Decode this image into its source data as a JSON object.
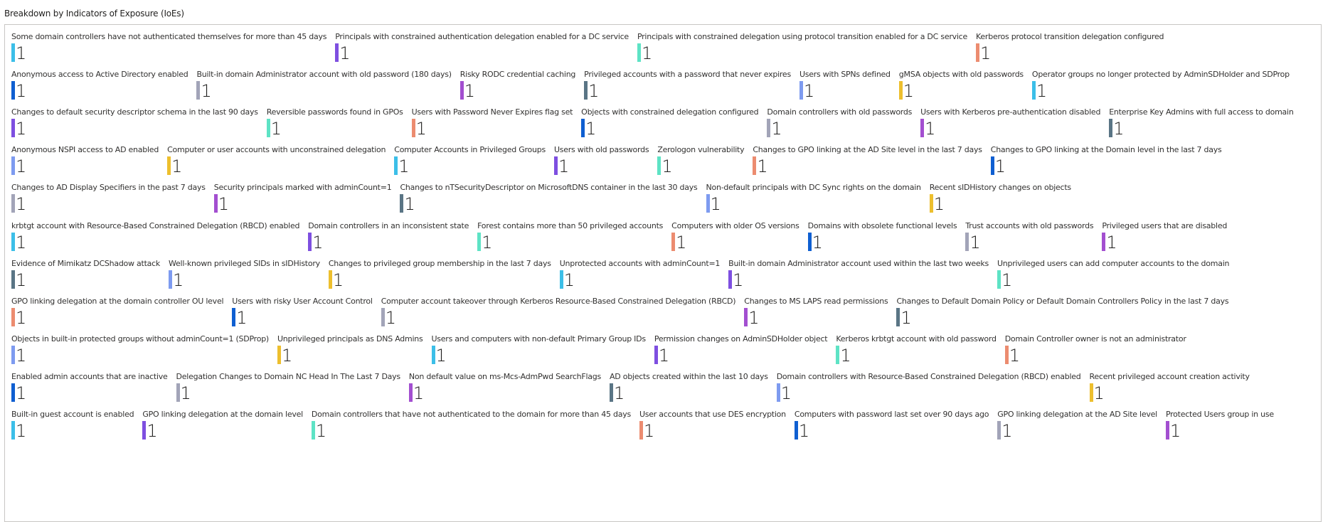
{
  "panel_title": "Breakdown by Indicators of Exposure (IoEs)",
  "colors": {
    "cyan": "#3cbfe8",
    "purple": "#7e4fe0",
    "mint": "#5ee3c5",
    "salmon": "#ec8c70",
    "blue": "#0f5fd1",
    "gray": "#a2a4b8",
    "magenta": "#a34fd0",
    "slate": "#5a7585",
    "periwinkle": "#7e9bf0",
    "gold": "#edbf2e"
  },
  "rows": [
    [
      {
        "label": "Some domain controllers have not authenticated themselves for more than 45 days",
        "value": "1",
        "color": "cyan"
      },
      {
        "label": "Principals with constrained authentication delegation enabled for a DC service",
        "value": "1",
        "color": "purple"
      },
      {
        "label": "Principals with constrained delegation using protocol transition enabled for a DC service",
        "value": "1",
        "color": "mint"
      },
      {
        "label": "Kerberos protocol transition delegation configured",
        "value": "1",
        "color": "salmon"
      }
    ],
    [
      {
        "label": "Anonymous access to Active Directory enabled",
        "value": "1",
        "color": "blue"
      },
      {
        "label": "Built-in domain Administrator account with old password (180 days)",
        "value": "1",
        "color": "gray"
      },
      {
        "label": "Risky RODC credential caching",
        "value": "1",
        "color": "magenta"
      },
      {
        "label": "Privileged accounts with a password that never expires",
        "value": "1",
        "color": "slate"
      },
      {
        "label": "Users with SPNs defined",
        "value": "1",
        "color": "periwinkle"
      },
      {
        "label": "gMSA objects with old passwords",
        "value": "1",
        "color": "gold"
      },
      {
        "label": "Operator groups no longer protected by AdminSDHolder and SDProp",
        "value": "1",
        "color": "cyan"
      }
    ],
    [
      {
        "label": "Changes to default security descriptor schema in the last 90 days",
        "value": "1",
        "color": "purple"
      },
      {
        "label": "Reversible passwords found in GPOs",
        "value": "1",
        "color": "mint"
      },
      {
        "label": "Users with Password Never Expires flag set",
        "value": "1",
        "color": "salmon"
      },
      {
        "label": "Objects with constrained delegation configured",
        "value": "1",
        "color": "blue"
      },
      {
        "label": "Domain controllers with old passwords",
        "value": "1",
        "color": "gray"
      },
      {
        "label": "Users with Kerberos pre-authentication disabled",
        "value": "1",
        "color": "magenta"
      },
      {
        "label": "Enterprise Key Admins with full access to domain",
        "value": "1",
        "color": "slate"
      }
    ],
    [
      {
        "label": "Anonymous NSPI access to AD enabled",
        "value": "1",
        "color": "periwinkle"
      },
      {
        "label": "Computer or user accounts with unconstrained delegation",
        "value": "1",
        "color": "gold"
      },
      {
        "label": "Computer Accounts in Privileged Groups",
        "value": "1",
        "color": "cyan"
      },
      {
        "label": "Users with old passwords",
        "value": "1",
        "color": "purple"
      },
      {
        "label": "Zerologon vulnerability",
        "value": "1",
        "color": "mint"
      },
      {
        "label": "Changes to GPO linking at the AD Site level in the last 7 days",
        "value": "1",
        "color": "salmon"
      },
      {
        "label": "Changes to GPO linking at the Domain level in the last 7 days",
        "value": "1",
        "color": "blue"
      }
    ],
    [
      {
        "label": "Changes to AD Display Specifiers in the past 7 days",
        "value": "1",
        "color": "gray"
      },
      {
        "label": "Security principals marked with adminCount=1",
        "value": "1",
        "color": "magenta"
      },
      {
        "label": "Changes to nTSecurityDescriptor on MicrosoftDNS container in the last 30 days",
        "value": "1",
        "color": "slate"
      },
      {
        "label": "Non-default principals with DC Sync rights on the domain",
        "value": "1",
        "color": "periwinkle"
      },
      {
        "label": "Recent sIDHistory changes on objects",
        "value": "1",
        "color": "gold"
      }
    ],
    [
      {
        "label": "krbtgt account with Resource-Based Constrained Delegation (RBCD) enabled",
        "value": "1",
        "color": "cyan"
      },
      {
        "label": "Domain controllers in an inconsistent state",
        "value": "1",
        "color": "purple"
      },
      {
        "label": "Forest contains more than 50 privileged accounts",
        "value": "1",
        "color": "mint"
      },
      {
        "label": "Computers with older OS versions",
        "value": "1",
        "color": "salmon"
      },
      {
        "label": "Domains with obsolete functional levels",
        "value": "1",
        "color": "blue"
      },
      {
        "label": "Trust accounts with old passwords",
        "value": "1",
        "color": "gray"
      },
      {
        "label": "Privileged users that are disabled",
        "value": "1",
        "color": "magenta"
      }
    ],
    [
      {
        "label": "Evidence of Mimikatz DCShadow attack",
        "value": "1",
        "color": "slate"
      },
      {
        "label": "Well-known privileged SIDs in sIDHistory",
        "value": "1",
        "color": "periwinkle"
      },
      {
        "label": "Changes to privileged group membership in the last 7 days",
        "value": "1",
        "color": "gold"
      },
      {
        "label": "Unprotected accounts with adminCount=1",
        "value": "1",
        "color": "cyan"
      },
      {
        "label": "Built-in domain Administrator account used within the last two weeks",
        "value": "1",
        "color": "purple"
      },
      {
        "label": "Unprivileged users can add computer accounts to the domain",
        "value": "1",
        "color": "mint"
      }
    ],
    [
      {
        "label": "GPO linking delegation at the domain controller OU level",
        "value": "1",
        "color": "salmon"
      },
      {
        "label": "Users with risky User Account Control",
        "value": "1",
        "color": "blue"
      },
      {
        "label": "Computer account takeover through Kerberos Resource-Based Constrained Delegation (RBCD)",
        "value": "1",
        "color": "gray"
      },
      {
        "label": "Changes to MS LAPS read permissions",
        "value": "1",
        "color": "magenta"
      },
      {
        "label": "Changes to Default Domain Policy or Default Domain Controllers Policy in the last 7 days",
        "value": "1",
        "color": "slate"
      }
    ],
    [
      {
        "label": "Objects in built-in protected groups without adminCount=1 (SDProp)",
        "value": "1",
        "color": "periwinkle"
      },
      {
        "label": "Unprivileged principals as DNS Admins",
        "value": "1",
        "color": "gold"
      },
      {
        "label": "Users and computers with non-default Primary Group IDs",
        "value": "1",
        "color": "cyan"
      },
      {
        "label": "Permission changes on AdminSDHolder object",
        "value": "1",
        "color": "purple"
      },
      {
        "label": "Kerberos krbtgt account with old password",
        "value": "1",
        "color": "mint"
      },
      {
        "label": "Domain Controller owner is not an administrator",
        "value": "1",
        "color": "salmon"
      }
    ],
    [
      {
        "label": "Enabled admin accounts that are inactive",
        "value": "1",
        "color": "blue"
      },
      {
        "label": "Delegation Changes to Domain NC Head In The Last 7 Days",
        "value": "1",
        "color": "gray"
      },
      {
        "label": "Non default value on ms-Mcs-AdmPwd SearchFlags",
        "value": "1",
        "color": "magenta"
      },
      {
        "label": "AD objects created within the last 10 days",
        "value": "1",
        "color": "slate"
      },
      {
        "label": "Domain controllers with Resource-Based Constrained Delegation (RBCD) enabled",
        "value": "1",
        "color": "periwinkle"
      },
      {
        "label": "Recent privileged account creation activity",
        "value": "1",
        "color": "gold"
      }
    ],
    [
      {
        "label": "Built-in guest account is enabled",
        "value": "1",
        "color": "cyan"
      },
      {
        "label": "GPO linking delegation at the domain level",
        "value": "1",
        "color": "purple"
      },
      {
        "label": "Domain controllers that have not authenticated to the domain for more than 45 days",
        "value": "1",
        "color": "mint"
      },
      {
        "label": "User accounts that use DES encryption",
        "value": "1",
        "color": "salmon"
      },
      {
        "label": "Computers with password last set over 90 days ago",
        "value": "1",
        "color": "blue"
      },
      {
        "label": "GPO linking delegation at the AD Site level",
        "value": "1",
        "color": "gray"
      },
      {
        "label": "Protected Users group in use",
        "value": "1",
        "color": "magenta"
      }
    ]
  ]
}
